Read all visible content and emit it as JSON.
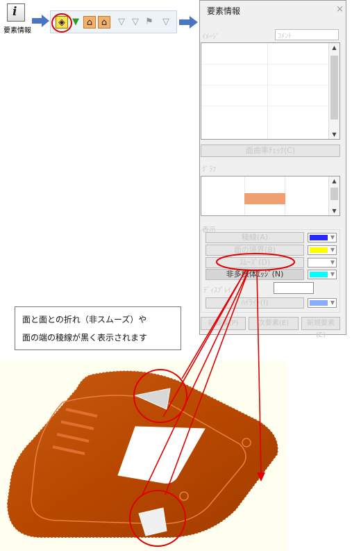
{
  "tool": {
    "icon": "info-icon",
    "label": "要素情報"
  },
  "toolbar": {
    "buttons": [
      "element-info-icon",
      "filter-icon",
      "face-select-icon",
      "edge-select-icon",
      "filter-off-icon",
      "flag-icon",
      "filter-group-icon",
      "filter-edit-icon"
    ]
  },
  "panel": {
    "title": "要素情報",
    "close": "×",
    "group1": "ｲﾒｰｼﾞ",
    "field1": "ｺﾒﾝﾄ",
    "check_button": "面曲率ﾁｪｯｸ(C)",
    "group2": "ｸﾞﾗﾌ",
    "group3": "表示",
    "rows": [
      {
        "label": "稜線(A)",
        "color": "#2a2aff"
      },
      {
        "label": "面の境界(B)",
        "color": "#ffff00"
      },
      {
        "label": "ｽﾑｰｽﾞ(D)",
        "color": "#ffffff"
      },
      {
        "label": "非多様体ｴｯｼﾞ(N)",
        "color": "#00ffff"
      }
    ],
    "extra_label": "ﾃﾞｨｽﾌﾟﾚｲ",
    "extra_row": {
      "label": "ﾊｲﾗｲﾄ(I)",
      "color": "#88aaff"
    },
    "bottom_buttons": [
      "前要素(P)",
      "次要素(E)",
      "新規要素(E)"
    ]
  },
  "note": {
    "line1": "面と面との折れ（非スムーズ）や",
    "line2": "面の端の稜線が黒く表示されます"
  }
}
